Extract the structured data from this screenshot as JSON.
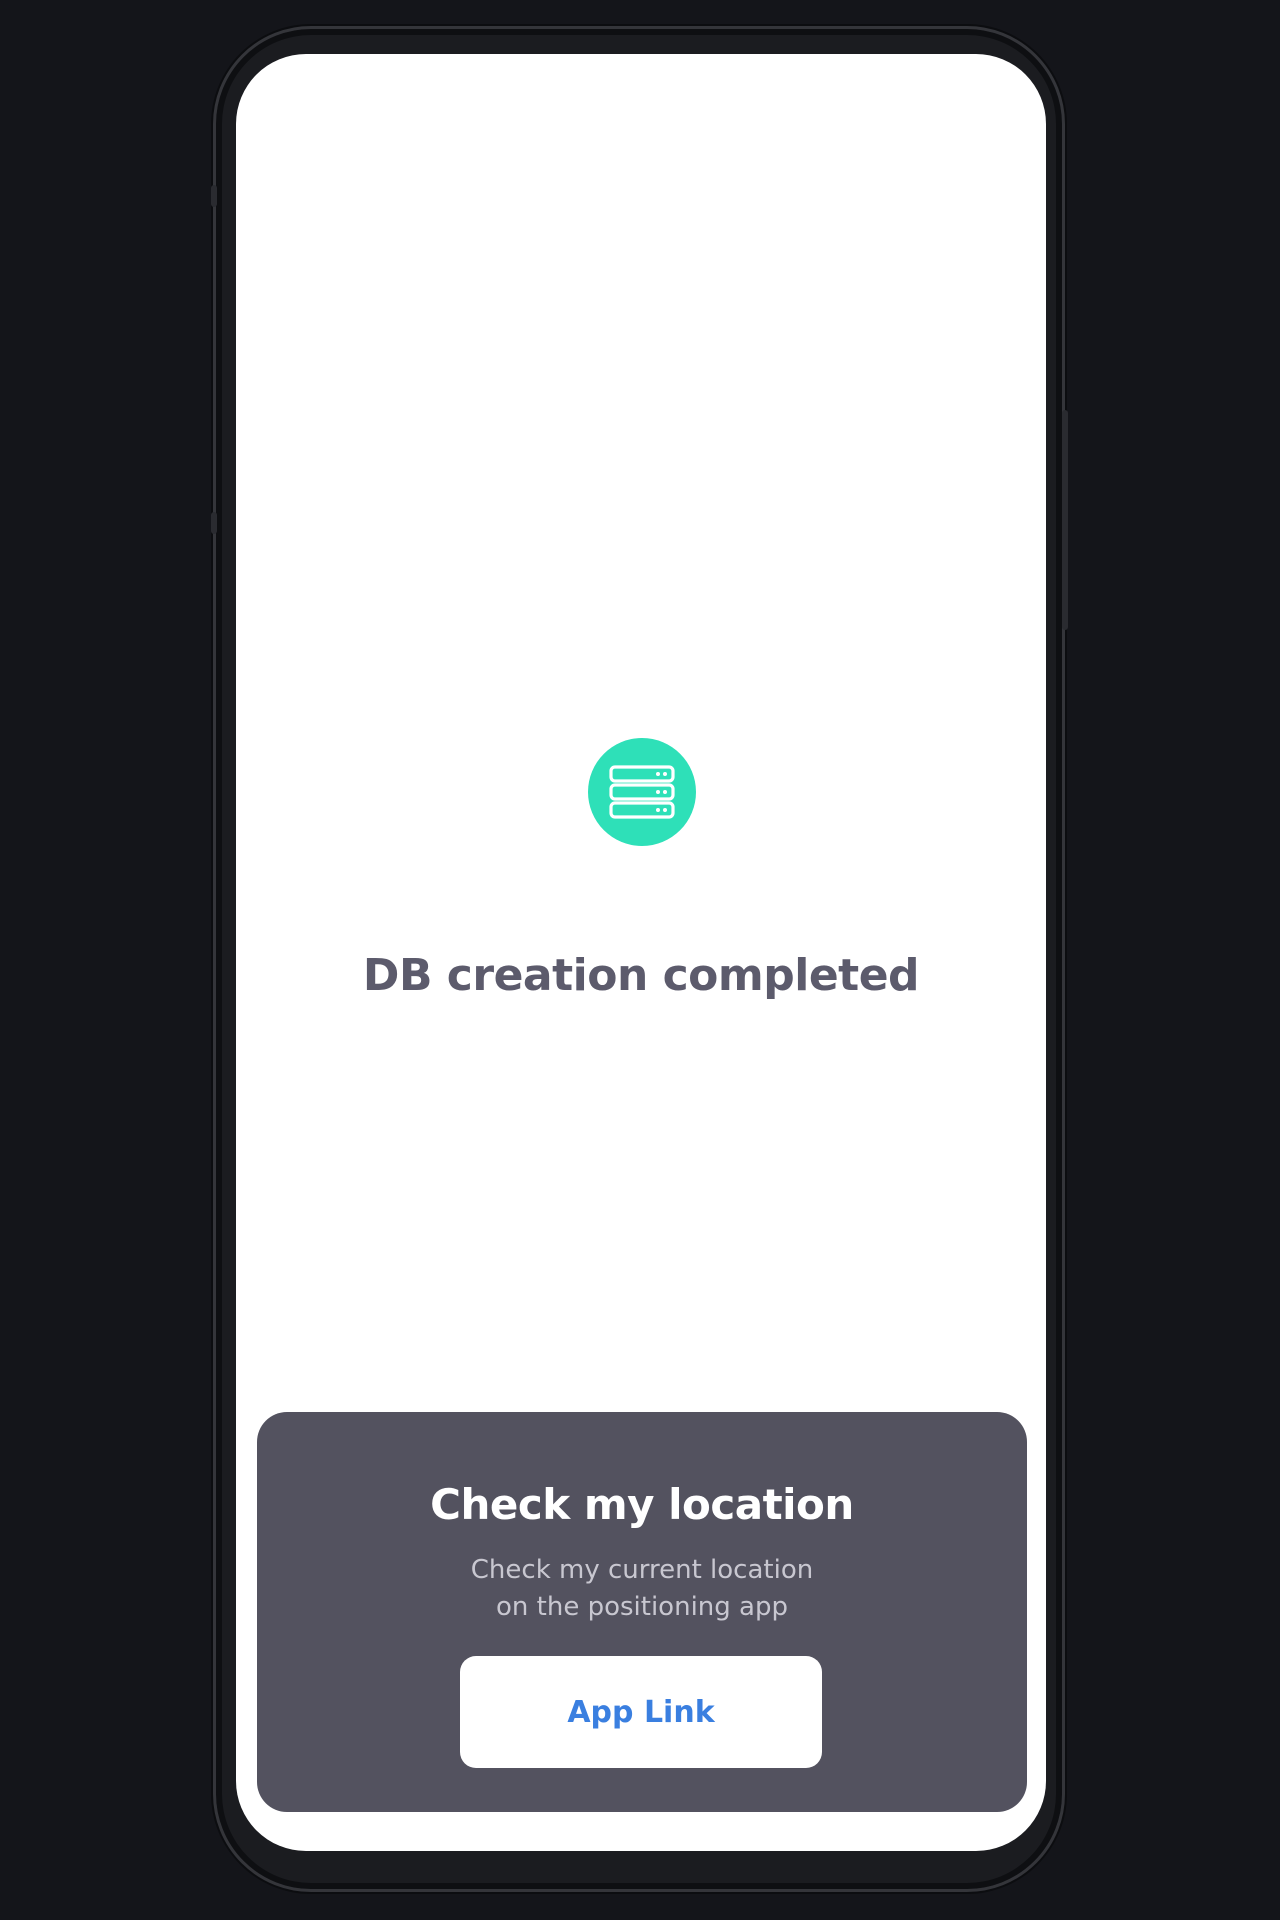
{
  "status": {
    "icon": "database-server-icon",
    "icon_color": "#2ee0b8",
    "title": "DB creation completed"
  },
  "location_card": {
    "title": "Check my location",
    "description_line1": "Check my current location",
    "description_line2": "on the positioning app",
    "button_label": "App Link",
    "button_color": "#3a7fe0",
    "background_color": "#53525f"
  }
}
